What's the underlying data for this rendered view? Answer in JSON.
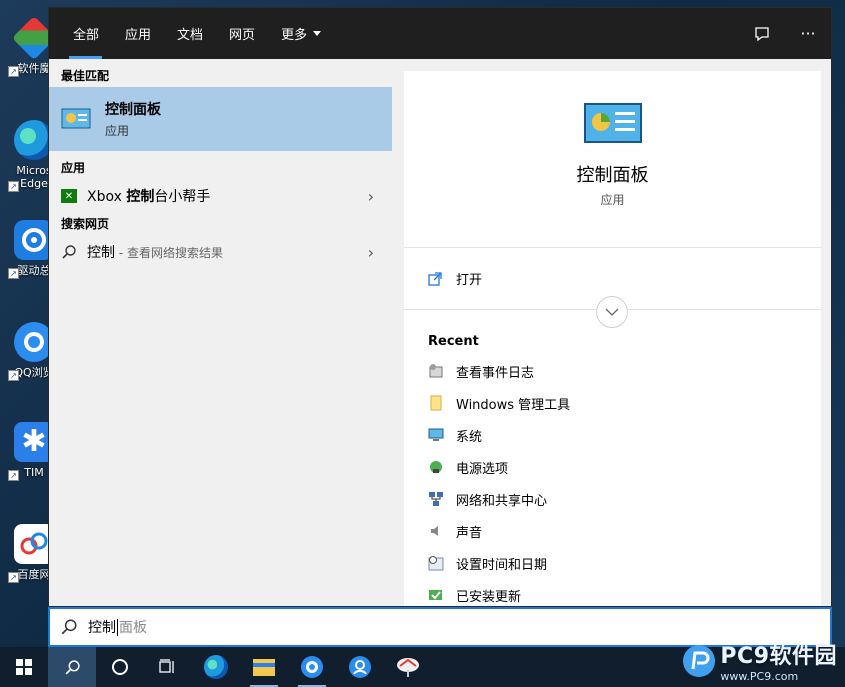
{
  "desktop": {
    "icons": [
      {
        "name": "软件魔"
      },
      {
        "name": "Micros Edge"
      },
      {
        "name": "驱动总"
      },
      {
        "name": "QQ浏览"
      },
      {
        "name": "TIM"
      },
      {
        "name": "百度网"
      }
    ]
  },
  "search_panel": {
    "tabs": [
      {
        "label": "全部",
        "active": true
      },
      {
        "label": "应用"
      },
      {
        "label": "文档"
      },
      {
        "label": "网页"
      },
      {
        "label": "更多"
      }
    ],
    "top_icons": [
      "feedback-icon",
      "more-options-icon"
    ],
    "more_glyph": "···",
    "left": {
      "best_match_header": "最佳匹配",
      "best_match": {
        "title": "控制面板",
        "subtitle": "应用"
      },
      "apps_header": "应用",
      "apps": [
        {
          "label_pre": "Xbox ",
          "label_bold": "控制",
          "label_post": "台小帮手"
        }
      ],
      "web_header": "搜索网页",
      "web": {
        "query": "控制",
        "hint": " - 查看网络搜索结果"
      }
    },
    "right": {
      "title": "控制面板",
      "type": "应用",
      "open_label": "打开",
      "recent_header": "Recent",
      "recent": [
        {
          "label": "查看事件日志",
          "icon": "event-viewer-icon"
        },
        {
          "label": "Windows 管理工具",
          "icon": "folder-icon"
        },
        {
          "label": "系统",
          "icon": "system-icon"
        },
        {
          "label": "电源选项",
          "icon": "power-options-icon"
        },
        {
          "label": "网络和共享中心",
          "icon": "network-icon"
        },
        {
          "label": "声音",
          "icon": "sound-icon"
        },
        {
          "label": "设置时间和日期",
          "icon": "date-time-icon"
        },
        {
          "label": "已安装更新",
          "icon": "installed-updates-icon"
        }
      ]
    }
  },
  "search_box": {
    "typed": "控制",
    "suggestion": "面板"
  },
  "taskbar": {
    "items": [
      "windows-start-icon",
      "search-icon",
      "cortana-icon",
      "task-view-icon",
      "edge-icon",
      "file-explorer-icon",
      "qq-browser-icon",
      "tim-icon",
      "app-icon"
    ]
  },
  "watermark": {
    "title": "PC9软件园",
    "url": "www.PC9.com"
  },
  "colors": {
    "accent": "#1e78d7",
    "selected": "#aacbe8",
    "topbar": "#1f1f1f",
    "taskbar": "#101e2e"
  }
}
